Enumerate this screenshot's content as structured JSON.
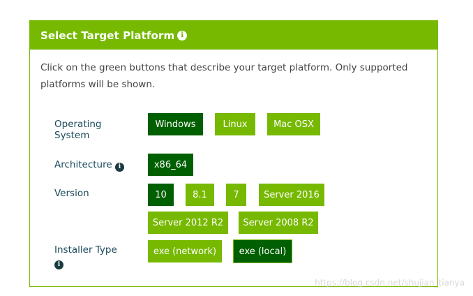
{
  "panel": {
    "title": "Select Target Platform",
    "intro_line1": "Click on the green buttons that describe your target platform. Only supported",
    "intro_line2": "platforms will be shown."
  },
  "rows": {
    "os": {
      "label_line1": "Operating",
      "label_line2": "System",
      "options": [
        "Windows",
        "Linux",
        "Mac OSX"
      ],
      "selected": "Windows"
    },
    "arch": {
      "label": "Architecture",
      "options": [
        "x86_64"
      ],
      "selected": "x86_64"
    },
    "version": {
      "label": "Version",
      "options": [
        "10",
        "8.1",
        "7",
        "Server 2016",
        "Server 2012 R2",
        "Server 2008 R2"
      ],
      "selected": "10"
    },
    "installer": {
      "label": "Installer Type",
      "options": [
        "exe (network)",
        "exe (local)"
      ],
      "selected": "exe (local)"
    }
  },
  "icons": {
    "info": "info-icon"
  },
  "colors": {
    "accent": "#76b900",
    "selected": "#005f00",
    "label": "#1a4a5a"
  },
  "watermark": "https://blog.csdn.net/shujian_tianya"
}
